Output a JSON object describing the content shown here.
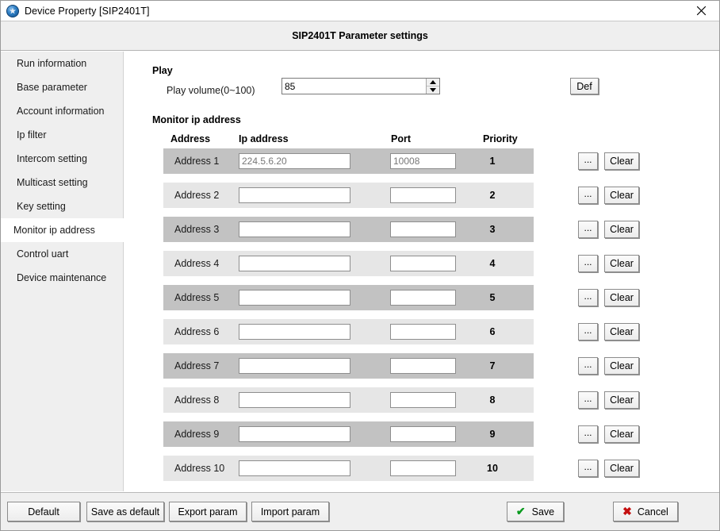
{
  "window": {
    "title": "Device Property [SIP2401T]",
    "app_icon": "globe-icon",
    "close_icon": "close-icon"
  },
  "header": {
    "title": "SIP2401T Parameter settings"
  },
  "sidebar": {
    "items": [
      {
        "label": "Run information",
        "selected": false
      },
      {
        "label": "Base parameter",
        "selected": false
      },
      {
        "label": "Account information",
        "selected": false
      },
      {
        "label": "Ip filter",
        "selected": false
      },
      {
        "label": "Intercom setting",
        "selected": false
      },
      {
        "label": "Multicast setting",
        "selected": false
      },
      {
        "label": "Key setting",
        "selected": false
      },
      {
        "label": "Monitor ip address",
        "selected": true
      },
      {
        "label": "Control uart",
        "selected": false
      },
      {
        "label": "Device maintenance",
        "selected": false
      }
    ]
  },
  "play": {
    "section_title": "Play",
    "volume_label": "Play volume(0~100)",
    "volume_value": "85",
    "spinner_up_icon": "triangle-up-icon",
    "spinner_down_icon": "triangle-down-icon",
    "def_button": "Def"
  },
  "monitor": {
    "section_title": "Monitor ip address",
    "columns": {
      "address": "Address",
      "ip": "Ip address",
      "port": "Port",
      "priority": "Priority"
    },
    "browse_label": "...",
    "clear_label": "Clear",
    "rows": [
      {
        "label": "Address 1",
        "ip": "224.5.6.20",
        "port": "10008",
        "priority": "1"
      },
      {
        "label": "Address 2",
        "ip": "",
        "port": "",
        "priority": "2"
      },
      {
        "label": "Address 3",
        "ip": "",
        "port": "",
        "priority": "3"
      },
      {
        "label": "Address 4",
        "ip": "",
        "port": "",
        "priority": "4"
      },
      {
        "label": "Address 5",
        "ip": "",
        "port": "",
        "priority": "5"
      },
      {
        "label": "Address 6",
        "ip": "",
        "port": "",
        "priority": "6"
      },
      {
        "label": "Address 7",
        "ip": "",
        "port": "",
        "priority": "7"
      },
      {
        "label": "Address 8",
        "ip": "",
        "port": "",
        "priority": "8"
      },
      {
        "label": "Address 9",
        "ip": "",
        "port": "",
        "priority": "9"
      },
      {
        "label": "Address 10",
        "ip": "",
        "port": "",
        "priority": "10"
      }
    ]
  },
  "footer": {
    "default": "Default",
    "save_as_default": "Save as default",
    "export_param": "Export param",
    "import_param": "Import param",
    "save": "Save",
    "save_icon": "check-icon",
    "cancel": "Cancel",
    "cancel_icon": "x-icon"
  },
  "colors": {
    "row_odd": "#c2c2c2",
    "row_even": "#e6e6e6",
    "chrome": "#efefef",
    "save_check": "#0a9a1e",
    "cancel_x": "#c40f0f"
  }
}
